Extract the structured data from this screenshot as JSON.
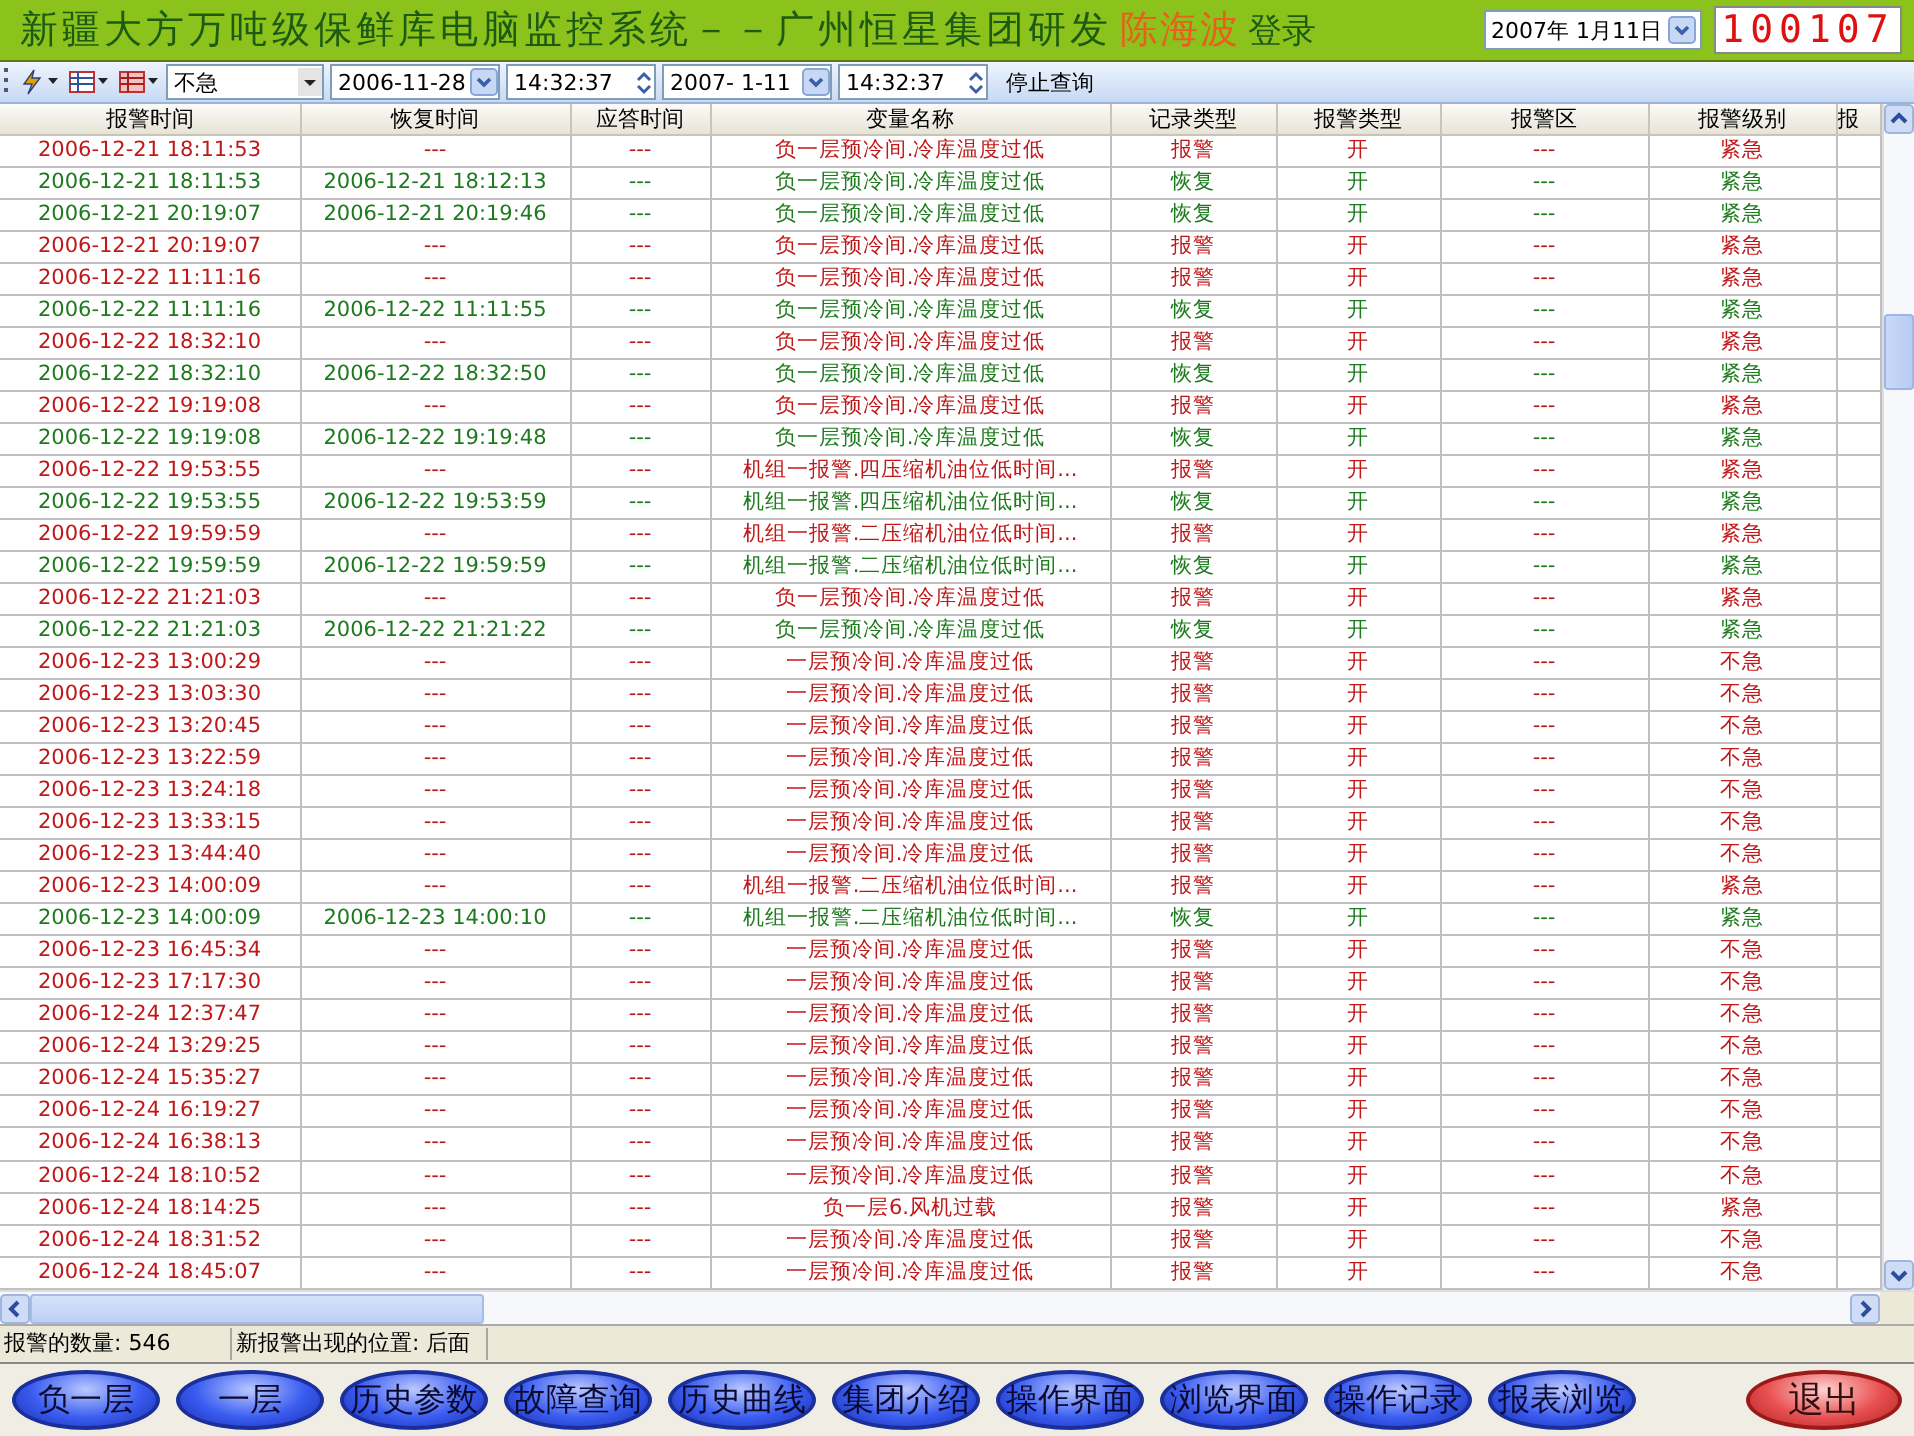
{
  "title": "新疆大方万吨级保鲜库电脑监控系统－－广州恒星集团研发",
  "user": "陈海波",
  "login_label": "登录",
  "date_picker": "2007年 1月11日",
  "clock": "100107",
  "toolbar": {
    "level_select": "不急",
    "start_date": "2006-11-28",
    "start_time": "14:32:37",
    "end_date": "2007- 1-11",
    "end_time": "14:32:37",
    "stop_button": "停止查询"
  },
  "table": {
    "columns": [
      "报警时间",
      "恢复时间",
      "应答时间",
      "变量名称",
      "记录类型",
      "报警类型",
      "报警区",
      "报警级别",
      "报"
    ],
    "rows": [
      {
        "kind": "alarm",
        "cells": [
          "2006-12-21 18:11:53",
          "---",
          "---",
          "负一层预冷间.冷库温度过低",
          "报警",
          "开",
          "---",
          "紧急"
        ]
      },
      {
        "kind": "recovery",
        "cells": [
          "2006-12-21 18:11:53",
          "2006-12-21 18:12:13",
          "---",
          "负一层预冷间.冷库温度过低",
          "恢复",
          "开",
          "---",
          "紧急"
        ]
      },
      {
        "kind": "recovery",
        "cells": [
          "2006-12-21 20:19:07",
          "2006-12-21 20:19:46",
          "---",
          "负一层预冷间.冷库温度过低",
          "恢复",
          "开",
          "---",
          "紧急"
        ]
      },
      {
        "kind": "alarm",
        "cells": [
          "2006-12-21 20:19:07",
          "---",
          "---",
          "负一层预冷间.冷库温度过低",
          "报警",
          "开",
          "---",
          "紧急"
        ]
      },
      {
        "kind": "alarm",
        "cells": [
          "2006-12-22 11:11:16",
          "---",
          "---",
          "负一层预冷间.冷库温度过低",
          "报警",
          "开",
          "---",
          "紧急"
        ]
      },
      {
        "kind": "recovery",
        "cells": [
          "2006-12-22 11:11:16",
          "2006-12-22 11:11:55",
          "---",
          "负一层预冷间.冷库温度过低",
          "恢复",
          "开",
          "---",
          "紧急"
        ]
      },
      {
        "kind": "alarm",
        "cells": [
          "2006-12-22 18:32:10",
          "---",
          "---",
          "负一层预冷间.冷库温度过低",
          "报警",
          "开",
          "---",
          "紧急"
        ]
      },
      {
        "kind": "recovery",
        "cells": [
          "2006-12-22 18:32:10",
          "2006-12-22 18:32:50",
          "---",
          "负一层预冷间.冷库温度过低",
          "恢复",
          "开",
          "---",
          "紧急"
        ]
      },
      {
        "kind": "alarm",
        "cells": [
          "2006-12-22 19:19:08",
          "---",
          "---",
          "负一层预冷间.冷库温度过低",
          "报警",
          "开",
          "---",
          "紧急"
        ]
      },
      {
        "kind": "recovery",
        "cells": [
          "2006-12-22 19:19:08",
          "2006-12-22 19:19:48",
          "---",
          "负一层预冷间.冷库温度过低",
          "恢复",
          "开",
          "---",
          "紧急"
        ]
      },
      {
        "kind": "alarm",
        "cells": [
          "2006-12-22 19:53:55",
          "---",
          "---",
          "机组一报警.四压缩机油位低时间...",
          "报警",
          "开",
          "---",
          "紧急"
        ]
      },
      {
        "kind": "recovery",
        "cells": [
          "2006-12-22 19:53:55",
          "2006-12-22 19:53:59",
          "---",
          "机组一报警.四压缩机油位低时间...",
          "恢复",
          "开",
          "---",
          "紧急"
        ]
      },
      {
        "kind": "alarm",
        "cells": [
          "2006-12-22 19:59:59",
          "---",
          "---",
          "机组一报警.二压缩机油位低时间...",
          "报警",
          "开",
          "---",
          "紧急"
        ]
      },
      {
        "kind": "recovery",
        "cells": [
          "2006-12-22 19:59:59",
          "2006-12-22 19:59:59",
          "---",
          "机组一报警.二压缩机油位低时间...",
          "恢复",
          "开",
          "---",
          "紧急"
        ]
      },
      {
        "kind": "alarm",
        "cells": [
          "2006-12-22 21:21:03",
          "---",
          "---",
          "负一层预冷间.冷库温度过低",
          "报警",
          "开",
          "---",
          "紧急"
        ]
      },
      {
        "kind": "recovery",
        "cells": [
          "2006-12-22 21:21:03",
          "2006-12-22 21:21:22",
          "---",
          "负一层预冷间.冷库温度过低",
          "恢复",
          "开",
          "---",
          "紧急"
        ]
      },
      {
        "kind": "alarm",
        "cells": [
          "2006-12-23 13:00:29",
          "---",
          "---",
          "一层预冷间.冷库温度过低",
          "报警",
          "开",
          "---",
          "不急"
        ]
      },
      {
        "kind": "alarm",
        "cells": [
          "2006-12-23 13:03:30",
          "---",
          "---",
          "一层预冷间.冷库温度过低",
          "报警",
          "开",
          "---",
          "不急"
        ]
      },
      {
        "kind": "alarm",
        "cells": [
          "2006-12-23 13:20:45",
          "---",
          "---",
          "一层预冷间.冷库温度过低",
          "报警",
          "开",
          "---",
          "不急"
        ]
      },
      {
        "kind": "alarm",
        "cells": [
          "2006-12-23 13:22:59",
          "---",
          "---",
          "一层预冷间.冷库温度过低",
          "报警",
          "开",
          "---",
          "不急"
        ]
      },
      {
        "kind": "alarm",
        "cells": [
          "2006-12-23 13:24:18",
          "---",
          "---",
          "一层预冷间.冷库温度过低",
          "报警",
          "开",
          "---",
          "不急"
        ]
      },
      {
        "kind": "alarm",
        "cells": [
          "2006-12-23 13:33:15",
          "---",
          "---",
          "一层预冷间.冷库温度过低",
          "报警",
          "开",
          "---",
          "不急"
        ]
      },
      {
        "kind": "alarm",
        "cells": [
          "2006-12-23 13:44:40",
          "---",
          "---",
          "一层预冷间.冷库温度过低",
          "报警",
          "开",
          "---",
          "不急"
        ]
      },
      {
        "kind": "alarm",
        "cells": [
          "2006-12-23 14:00:09",
          "---",
          "---",
          "机组一报警.二压缩机油位低时间...",
          "报警",
          "开",
          "---",
          "紧急"
        ]
      },
      {
        "kind": "recovery",
        "cells": [
          "2006-12-23 14:00:09",
          "2006-12-23 14:00:10",
          "---",
          "机组一报警.二压缩机油位低时间...",
          "恢复",
          "开",
          "---",
          "紧急"
        ]
      },
      {
        "kind": "alarm",
        "cells": [
          "2006-12-23 16:45:34",
          "---",
          "---",
          "一层预冷间.冷库温度过低",
          "报警",
          "开",
          "---",
          "不急"
        ]
      },
      {
        "kind": "alarm",
        "cells": [
          "2006-12-23 17:17:30",
          "---",
          "---",
          "一层预冷间.冷库温度过低",
          "报警",
          "开",
          "---",
          "不急"
        ]
      },
      {
        "kind": "alarm",
        "cells": [
          "2006-12-24 12:37:47",
          "---",
          "---",
          "一层预冷间.冷库温度过低",
          "报警",
          "开",
          "---",
          "不急"
        ]
      },
      {
        "kind": "alarm",
        "cells": [
          "2006-12-24 13:29:25",
          "---",
          "---",
          "一层预冷间.冷库温度过低",
          "报警",
          "开",
          "---",
          "不急"
        ]
      },
      {
        "kind": "alarm",
        "cells": [
          "2006-12-24 15:35:27",
          "---",
          "---",
          "一层预冷间.冷库温度过低",
          "报警",
          "开",
          "---",
          "不急"
        ]
      },
      {
        "kind": "alarm",
        "cells": [
          "2006-12-24 16:19:27",
          "---",
          "---",
          "一层预冷间.冷库温度过低",
          "报警",
          "开",
          "---",
          "不急"
        ]
      },
      {
        "kind": "alarm",
        "cells": [
          "2006-12-24 16:38:13",
          "---",
          "---",
          "一层预冷间.冷库温度过低",
          "报警",
          "开",
          "---",
          "不急"
        ]
      },
      {
        "kind": "alarm",
        "cells": [
          "2006-12-24 18:10:52",
          "---",
          "---",
          "一层预冷间.冷库温度过低",
          "报警",
          "开",
          "---",
          "不急"
        ]
      },
      {
        "kind": "alarm",
        "cells": [
          "2006-12-24 18:14:25",
          "---",
          "---",
          "负一层6.风机过载",
          "报警",
          "开",
          "---",
          "紧急"
        ]
      },
      {
        "kind": "alarm",
        "cells": [
          "2006-12-24 18:31:52",
          "---",
          "---",
          "一层预冷间.冷库温度过低",
          "报警",
          "开",
          "---",
          "不急"
        ]
      },
      {
        "kind": "alarm",
        "cells": [
          "2006-12-24 18:45:07",
          "---",
          "---",
          "一层预冷间.冷库温度过低",
          "报警",
          "开",
          "---",
          "不急"
        ]
      }
    ]
  },
  "status_bar": [
    "报警的数量: 546",
    "新报警出现的位置: 后面"
  ],
  "nav_buttons": [
    {
      "kind": "nav",
      "label": "负一层"
    },
    {
      "kind": "nav",
      "label": "一层"
    },
    {
      "kind": "nav",
      "label": "历史参数"
    },
    {
      "kind": "nav",
      "label": "故障查询"
    },
    {
      "kind": "nav",
      "label": "历史曲线"
    },
    {
      "kind": "nav",
      "label": "集团介绍"
    },
    {
      "kind": "nav",
      "label": "操作界面"
    },
    {
      "kind": "nav",
      "label": "浏览界面"
    },
    {
      "kind": "nav",
      "label": "操作记录"
    },
    {
      "kind": "nav",
      "label": "报表浏览"
    },
    {
      "kind": "exit",
      "label": "退出"
    }
  ]
}
